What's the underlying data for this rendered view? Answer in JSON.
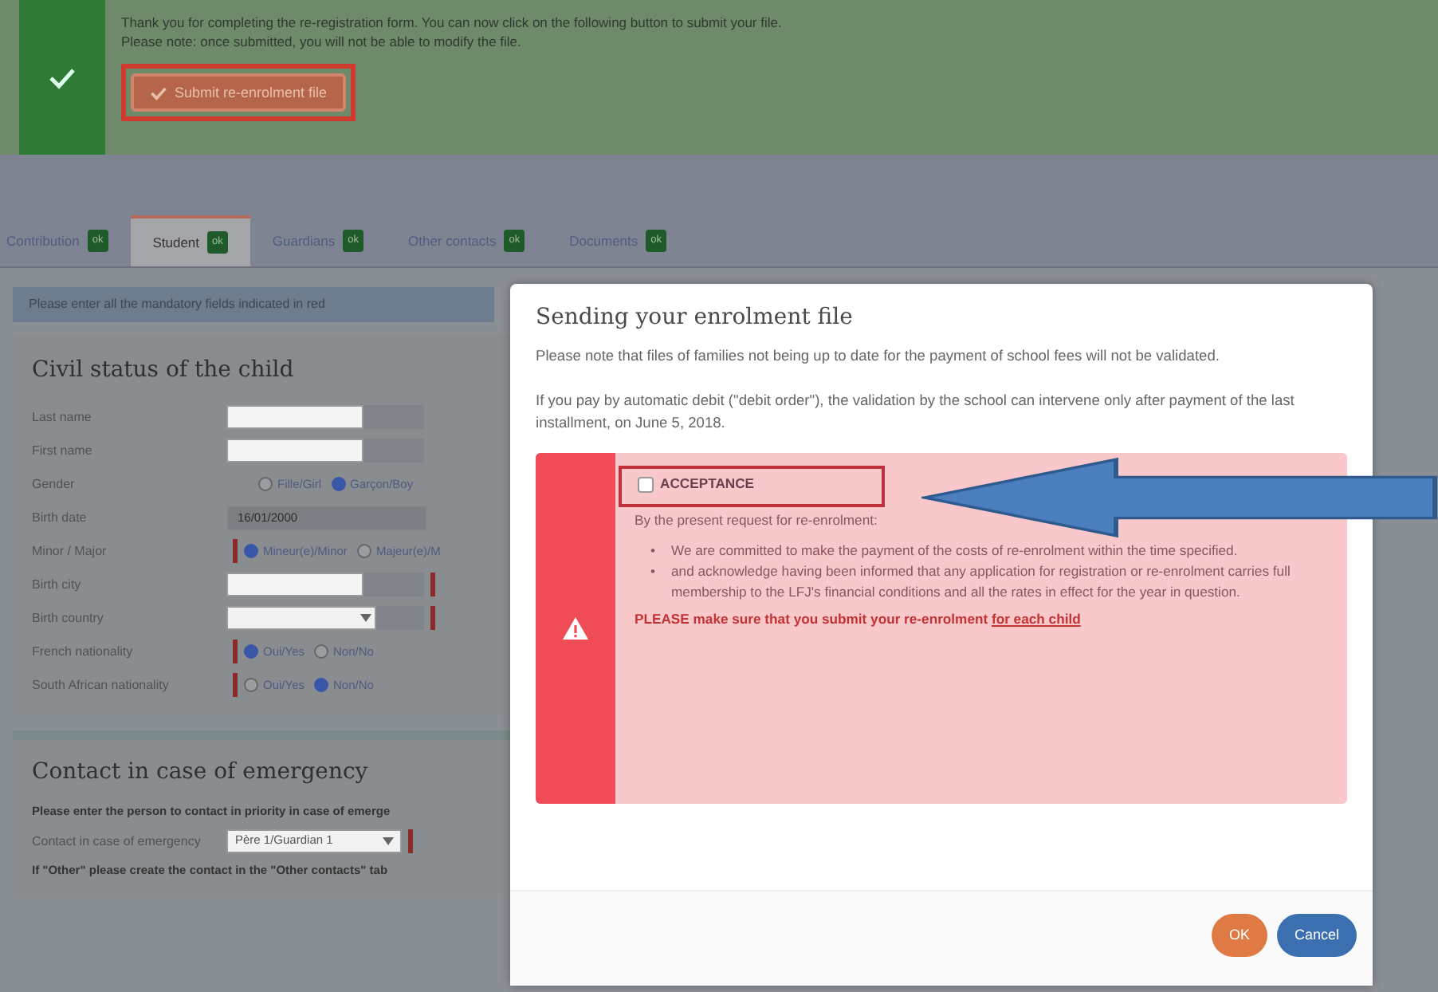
{
  "notice": {
    "lines": [
      "Thank you for completing the re-registration form. You can now click on the following button to submit your file.",
      "Please note: once submitted, you will not be able to modify the file."
    ],
    "button": "Submit re-enrolment file"
  },
  "tabs": [
    {
      "label": "Contribution",
      "badge": "ok",
      "selected": false
    },
    {
      "label": "Student",
      "badge": "ok",
      "selected": true
    },
    {
      "label": "Guardians",
      "badge": "ok",
      "selected": false
    },
    {
      "label": "Other contacts",
      "badge": "ok",
      "selected": false
    },
    {
      "label": "Documents",
      "badge": "ok",
      "selected": false
    }
  ],
  "info_bar": "Please enter all the mandatory fields indicated in red",
  "civil_status": {
    "title": "Civil status of the child",
    "fields": [
      {
        "label": "Last name",
        "kind": "text",
        "required": false
      },
      {
        "label": "First name",
        "kind": "text",
        "required": false
      },
      {
        "label": "Gender",
        "kind": "radio",
        "required": false,
        "options": [
          {
            "label": "Fille/Girl",
            "selected": false
          },
          {
            "label": "Garçon/Boy",
            "selected": true
          }
        ]
      },
      {
        "label": "Birth date",
        "kind": "readonly",
        "required": false,
        "value": "16/01/2000"
      },
      {
        "label": "Minor / Major",
        "kind": "radio",
        "required": true,
        "options": [
          {
            "label": "Mineur(e)/Minor",
            "selected": true
          },
          {
            "label": "Majeur(e)/M",
            "selected": false
          }
        ]
      },
      {
        "label": "Birth city",
        "kind": "text",
        "required": true
      },
      {
        "label": "Birth country",
        "kind": "select",
        "required": true
      },
      {
        "label": "French nationality",
        "kind": "radio",
        "required": true,
        "options": [
          {
            "label": "Oui/Yes",
            "selected": true
          },
          {
            "label": "Non/No",
            "selected": false
          }
        ]
      },
      {
        "label": "South African nationality",
        "kind": "radio",
        "required": true,
        "options": [
          {
            "label": "Oui/Yes",
            "selected": false
          },
          {
            "label": "Non/No",
            "selected": true
          }
        ]
      }
    ]
  },
  "emergency": {
    "title": "Contact in case of emergency",
    "note": "Please enter the person to contact in priority in case of emerge",
    "field": {
      "label": "Contact in case of emergency",
      "value": "Père 1/Guardian 1",
      "required": true
    },
    "hint": "If \"Other\" please create the contact in the \"Other contacts\" tab"
  },
  "modal": {
    "title": "Sending your enrolment file",
    "paragraphs": [
      "Please note that files of families not being up to date for the payment of school fees will not be validated.",
      "If you pay by automatic debit (\"debit order\"), the validation by the school can intervene only after payment of the last installment, on June 5, 2018."
    ],
    "alert": {
      "checkbox": {
        "label": "ACCEPTANCE",
        "checked": false
      },
      "intro": "By the present request for re-enrolment:",
      "bullets": [
        {
          "marker": "•",
          "text": "We are committed to make the payment of the costs of re-enrolment within the time specified."
        },
        {
          "marker": "•",
          "text": "and acknowledge having been informed that any application for registration or re-enrolment carries full membership to the LFJ's financial conditions and all the rates in effect for the year in question."
        }
      ],
      "warning": "PLEASE make sure that you submit your re-enrolment",
      "warning_link": "for each child"
    },
    "buttons": [
      {
        "label": "OK",
        "kind": "ok"
      },
      {
        "label": "Cancel",
        "kind": "cancel"
      }
    ]
  }
}
